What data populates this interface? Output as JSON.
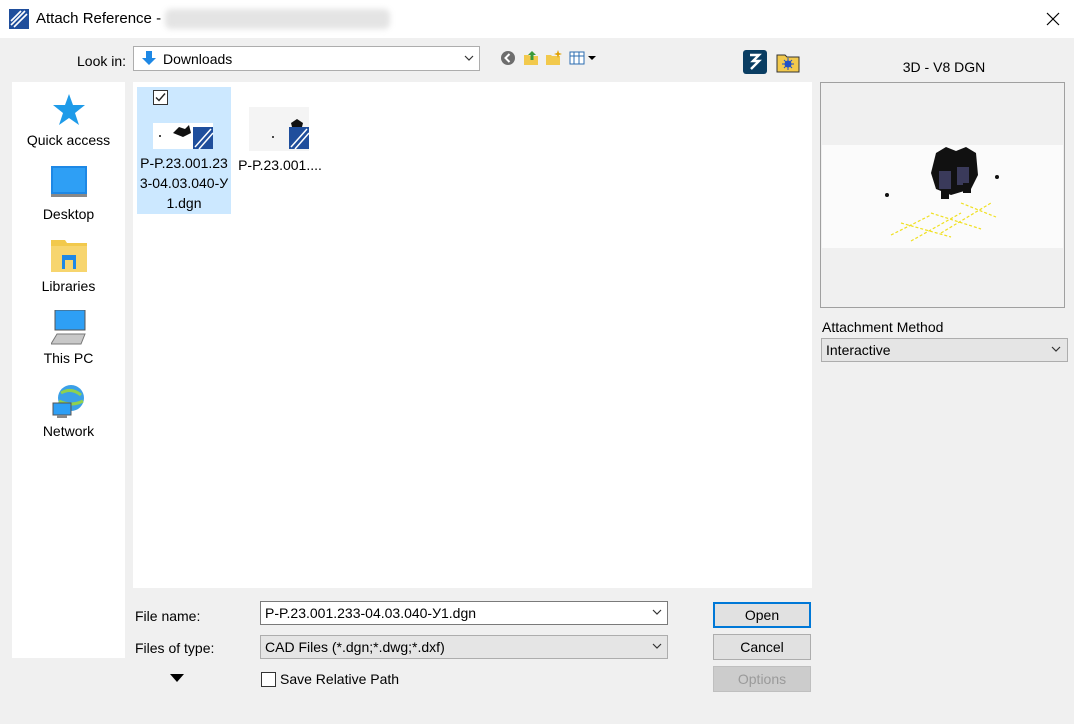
{
  "window": {
    "title": "Attach Reference -"
  },
  "look_in": {
    "label": "Look in:",
    "value": "Downloads"
  },
  "toolbar": {
    "icons": [
      "back-icon",
      "up-folder-icon",
      "new-folder-icon",
      "view-menu-icon",
      "bentley-icon",
      "config-folder-icon"
    ]
  },
  "places": [
    {
      "label": "Quick access",
      "icon": "star-icon"
    },
    {
      "label": "Desktop",
      "icon": "desktop-icon"
    },
    {
      "label": "Libraries",
      "icon": "libraries-icon"
    },
    {
      "label": "This PC",
      "icon": "computer-icon"
    },
    {
      "label": "Network",
      "icon": "network-icon"
    }
  ],
  "files": [
    {
      "name": "P-P.23.001.233-04.03.040-У1.dgn",
      "selected": true,
      "checked": true
    },
    {
      "name": "P-P.23.001....",
      "selected": false,
      "checked": false
    }
  ],
  "file_name": {
    "label": "File name:",
    "value": "P-P.23.001.233-04.03.040-У1.dgn"
  },
  "file_type": {
    "label": "Files of type:",
    "value": "CAD Files (*.dgn;*.dwg;*.dxf)"
  },
  "buttons": {
    "open": "Open",
    "cancel": "Cancel",
    "options": "Options"
  },
  "save_relative_path": {
    "label": "Save Relative Path",
    "checked": false
  },
  "preview": {
    "title": "3D - V8 DGN"
  },
  "attachment_method": {
    "label": "Attachment Method",
    "value": "Interactive"
  },
  "colors": {
    "selection": "#cce8ff",
    "accent": "#0078d7"
  }
}
